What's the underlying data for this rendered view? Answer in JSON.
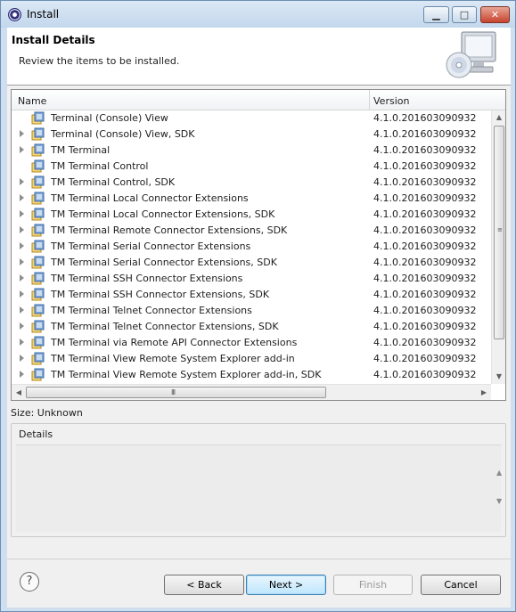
{
  "window": {
    "title": "Install",
    "minimize_label": "▁",
    "maximize_label": "□",
    "close_label": "✕"
  },
  "header": {
    "title": "Install Details",
    "description": "Review the items to be installed.",
    "icon": "monitor-cd-icon"
  },
  "table": {
    "columns": [
      "Name",
      "Version"
    ],
    "rows": [
      {
        "name": "Terminal (Console) View",
        "version": "4.1.0.201603090932",
        "expandable": false
      },
      {
        "name": "Terminal (Console) View, SDK",
        "version": "4.1.0.201603090932",
        "expandable": true
      },
      {
        "name": "TM Terminal",
        "version": "4.1.0.201603090932",
        "expandable": true
      },
      {
        "name": "TM Terminal Control",
        "version": "4.1.0.201603090932",
        "expandable": false
      },
      {
        "name": "TM Terminal Control, SDK",
        "version": "4.1.0.201603090932",
        "expandable": true
      },
      {
        "name": "TM Terminal Local Connector Extensions",
        "version": "4.1.0.201603090932",
        "expandable": true
      },
      {
        "name": "TM Terminal Local Connector Extensions, SDK",
        "version": "4.1.0.201603090932",
        "expandable": true
      },
      {
        "name": "TM Terminal Remote Connector Extensions, SDK",
        "version": "4.1.0.201603090932",
        "expandable": true
      },
      {
        "name": "TM Terminal Serial Connector Extensions",
        "version": "4.1.0.201603090932",
        "expandable": true
      },
      {
        "name": "TM Terminal Serial Connector Extensions, SDK",
        "version": "4.1.0.201603090932",
        "expandable": true
      },
      {
        "name": "TM Terminal SSH Connector Extensions",
        "version": "4.1.0.201603090932",
        "expandable": true
      },
      {
        "name": "TM Terminal SSH Connector Extensions, SDK",
        "version": "4.1.0.201603090932",
        "expandable": true
      },
      {
        "name": "TM Terminal Telnet Connector Extensions",
        "version": "4.1.0.201603090932",
        "expandable": true
      },
      {
        "name": "TM Terminal Telnet Connector Extensions, SDK",
        "version": "4.1.0.201603090932",
        "expandable": true
      },
      {
        "name": "TM Terminal via Remote API Connector Extensions",
        "version": "4.1.0.201603090932",
        "expandable": true
      },
      {
        "name": "TM Terminal View Remote System Explorer add-in",
        "version": "4.1.0.201603090932",
        "expandable": true
      },
      {
        "name": "TM Terminal View Remote System Explorer add-in, SDK",
        "version": "4.1.0.201603090932",
        "expandable": true
      }
    ],
    "row_icon": "feature-plugin-icon"
  },
  "scroll": {
    "up": "▲",
    "down": "▼",
    "left": "◀",
    "right": "▶",
    "hgrip": "III",
    "vgrip": "≡"
  },
  "size_text": "Size: Unknown",
  "details": {
    "label": "Details",
    "up": "▲",
    "down": "▼"
  },
  "footer": {
    "help": "?",
    "back": "< Back",
    "next": "Next >",
    "finish": "Finish",
    "cancel": "Cancel"
  },
  "colors": {
    "window_frame": "#cfdff0",
    "client_bg": "#f0f0f0",
    "default_button": "#bee6fd",
    "close_button": "#c8442d"
  }
}
